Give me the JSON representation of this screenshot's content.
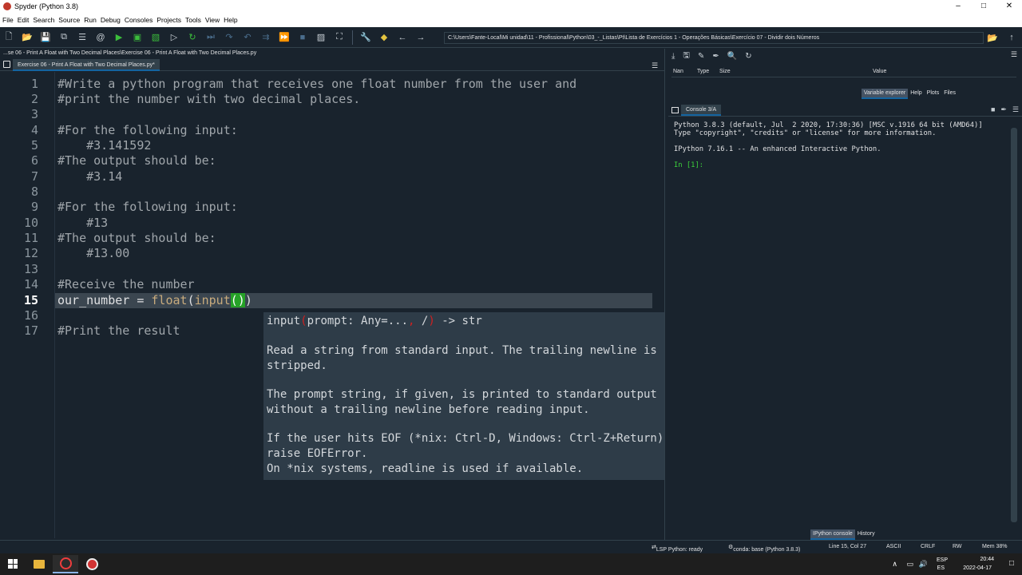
{
  "window": {
    "title": "Spyder (Python 3.8)",
    "controls": [
      "–",
      "□",
      "✕"
    ]
  },
  "menu": [
    "File",
    "Edit",
    "Search",
    "Source",
    "Run",
    "Debug",
    "Consoles",
    "Projects",
    "Tools",
    "View",
    "Help"
  ],
  "toolbar": {
    "path": "C:\\Users\\Fante-Local\\Mi unidad\\11 - Profissional\\Python\\03_-_Listas\\Pt\\Lista de Exercícios 1 - Operações Básicas\\Exercício 07 - Dividir dois Números"
  },
  "editor": {
    "file_path": "...se 06 - Print A Float with Two Decimal Places\\Exercise 06 - Print A Float with Two Decimal Places.py",
    "tab": "Exercise 06 - Print A Float with Two Decimal Places.py*",
    "lines": [
      "#Write a python program that receives one float number from the user and",
      "#print the number with two decimal places.",
      "",
      "#For the following input:",
      "    #3.141592",
      "#The output should be:",
      "    #3.14",
      "",
      "#For the following input:",
      "    #13",
      "#The output should be:",
      "    #13.00",
      "",
      "#Receive the number",
      "our_number = float(input())",
      "",
      "#Print the result"
    ],
    "line_numbers": [
      "1",
      "2",
      "3",
      "4",
      "5",
      "6",
      "7",
      "8",
      "9",
      "10",
      "11",
      "12",
      "13",
      "14",
      "15",
      "16",
      "17"
    ],
    "current_line": "15",
    "line15": {
      "var": "our_number = ",
      "fn1": "float",
      "p1": "(",
      "fn2": "input",
      "parens": "()",
      "p2": ")"
    },
    "calltip": {
      "sig_fn": "input",
      "sig_open": "(",
      "sig_args": "prompt: Any=...",
      "sig_comma": ",",
      "sig_slash": " /",
      "sig_close": ")",
      "sig_ret": " -> str",
      "para1": "Read a string from standard input. The trailing newline is\nstripped.",
      "para2": "The prompt string, if given, is printed to standard output\nwithout a trailing newline before reading input.",
      "para3": "If the user hits EOF (*nix: Ctrl-D, Windows: Ctrl-Z+Return),\nraise EOFError.\nOn *nix systems, readline is used if available."
    }
  },
  "variable_explorer": {
    "columns": [
      "Nan",
      "Type",
      "Size",
      "Value"
    ],
    "tabs": [
      "Variable explorer",
      "Help",
      "Plots",
      "Files"
    ]
  },
  "console": {
    "tab": "Console 3/A",
    "lines": [
      "Python 3.8.3 (default, Jul  2 2020, 17:30:36) [MSC v.1916 64 bit (AMD64)]",
      "Type \"copyright\", \"credits\" or \"license\" for more information.",
      "",
      "IPython 7.16.1 -- An enhanced Interactive Python.",
      "",
      "In [1]:"
    ],
    "bottom_tabs": [
      "IPython console",
      "History"
    ]
  },
  "status": {
    "lsp": "LSP Python: ready",
    "conda": "conda: base (Python 3.8.3)",
    "position": "Line 15, Col 27",
    "encoding": "ASCII",
    "eol": "CRLF",
    "mode": "RW",
    "memory": "Mem 38%"
  },
  "taskbar": {
    "lang_top": "ESP",
    "lang_bottom": "ES",
    "time": "20:44",
    "date": "2022-04-17"
  },
  "colors": {
    "background": "#19232d",
    "accent": "#1464a0",
    "match_paren": "#26a227"
  }
}
